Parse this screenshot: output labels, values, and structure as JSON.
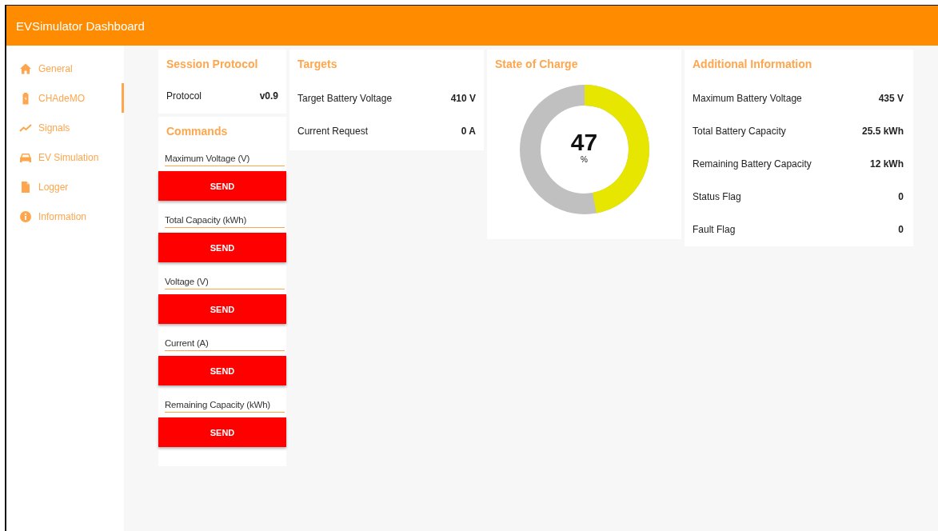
{
  "header": {
    "title": "EVSimulator Dashboard"
  },
  "sidebar": {
    "items": [
      {
        "label": "General",
        "selected": false
      },
      {
        "label": "CHAdeMO",
        "selected": true
      },
      {
        "label": "Signals",
        "selected": false
      },
      {
        "label": "EV Simulation",
        "selected": false
      },
      {
        "label": "Logger",
        "selected": false
      },
      {
        "label": "Information",
        "selected": false
      }
    ]
  },
  "session_protocol": {
    "title": "Session Protocol",
    "rows": [
      {
        "label": "Protocol",
        "value": "v0.9"
      }
    ]
  },
  "commands": {
    "title": "Commands",
    "items": [
      {
        "placeholder": "Maximum Voltage (V)",
        "button": "SEND"
      },
      {
        "placeholder": "Total Capacity (kWh)",
        "button": "SEND"
      },
      {
        "placeholder": "Voltage (V)",
        "button": "SEND"
      },
      {
        "placeholder": "Current (A)",
        "button": "SEND"
      },
      {
        "placeholder": "Remaining Capacity (kWh)",
        "button": "SEND"
      }
    ]
  },
  "targets": {
    "title": "Targets",
    "rows": [
      {
        "label": "Target Battery Voltage",
        "value": "410 V"
      },
      {
        "label": "Current Request",
        "value": "0 A"
      }
    ]
  },
  "state_of_charge": {
    "title": "State of Charge",
    "level": 0.47,
    "value": "47",
    "unit": "%"
  },
  "additional_information": {
    "title": "Additional Information",
    "rows": [
      {
        "label": "Maximum Battery Voltage",
        "value": "435 V"
      },
      {
        "label": "Total Battery Capacity",
        "value": "25.5 kWh"
      },
      {
        "label": "Remaining Battery Capacity",
        "value": "12 kWh"
      },
      {
        "label": "Status Flag",
        "value": "0"
      },
      {
        "label": "Fault Flag",
        "value": "0"
      }
    ]
  }
}
